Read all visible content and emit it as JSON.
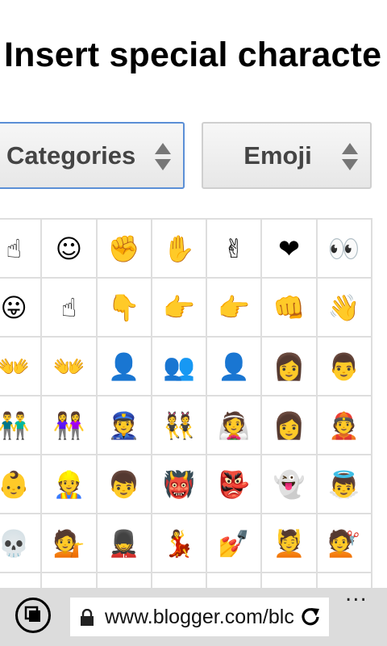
{
  "page": {
    "title": "Insert special characte"
  },
  "selects": {
    "category": "Categories",
    "subcategory": "Emoji"
  },
  "emoji_grid": [
    [
      "☝",
      "☺",
      "✊",
      "✋",
      "✌",
      "❤",
      "👀"
    ],
    [
      "😛",
      "☝",
      "👇",
      "👉",
      "👉",
      "👊",
      "👋"
    ],
    [
      "👐",
      "👐",
      "👤",
      "👥",
      "👤",
      "👩",
      "👨"
    ],
    [
      "👬",
      "👭",
      "👮",
      "👯",
      "👰",
      "👩",
      "👲"
    ],
    [
      "👶",
      "👷",
      "👦",
      "👹",
      "👺",
      "👻",
      "👼"
    ],
    [
      "💀",
      "💁",
      "💂",
      "💃",
      "💅",
      "💆",
      "💇"
    ],
    [
      "",
      "",
      "",
      "",
      "",
      "",
      ""
    ]
  ],
  "browser": {
    "url": "www.blogger.com/blc",
    "more_label": "..."
  },
  "colors": {
    "focus_border": "#5b8fd6",
    "grid_line": "#dedede",
    "bottom_bar": "#dcdcdc"
  }
}
